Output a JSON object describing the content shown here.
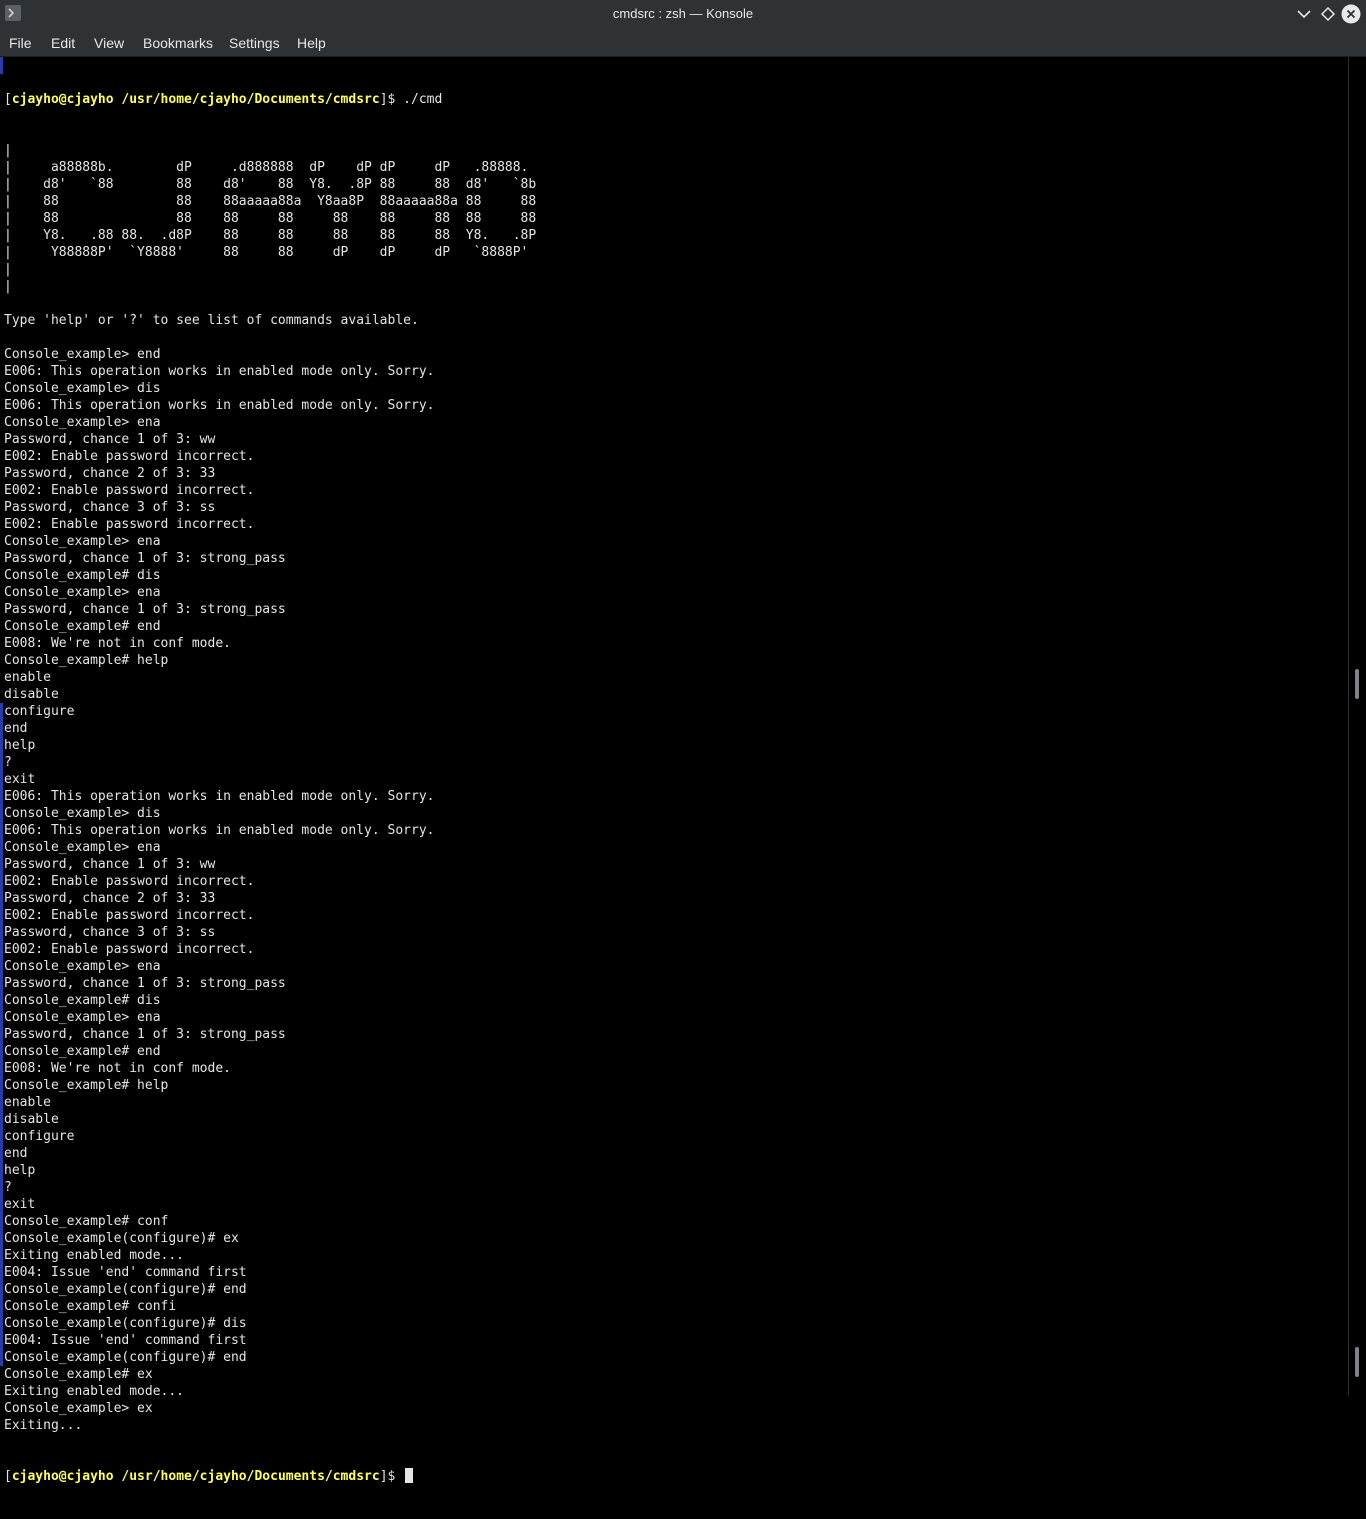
{
  "window": {
    "title": "cmdsrc : zsh — Konsole",
    "icons": {
      "app": "terminal-icon",
      "minimize": "chevron-down-icon",
      "maximize": "diamond-icon",
      "close": "close-icon"
    }
  },
  "menu": {
    "items": [
      "File",
      "Edit",
      "View",
      "Bookmarks",
      "Settings",
      "Help"
    ]
  },
  "colors": {
    "background": "#000000",
    "text": "#e5e5e5",
    "prompt": "#ffff55",
    "chrome": "#2f3235",
    "marker": "#2c3aa8"
  },
  "prompt": {
    "open": "[",
    "user_host": "cjayho@cjayho",
    "path": "/usr/home/cjayho/Documents/cmdsrc",
    "close": "]$ ",
    "first_command": "./cmd"
  },
  "terminal": {
    "lines": [
      "|",
      "|     a88888b.        dP     .d888888  dP    dP dP     dP   .88888.",
      "|    d8'   `88        88    d8'    88  Y8.  .8P 88     88  d8'   `8b",
      "|    88               88    88aaaaa88a  Y8aa8P  88aaaaa88a 88     88",
      "|    88               88    88     88     88    88     88  88     88",
      "|    Y8.   .88 88.  .d8P    88     88     88    88     88  Y8.   .8P",
      "|     Y88888P'  `Y8888'     88     88     dP    dP     dP   `8888P'",
      "|",
      "|",
      "",
      "Type 'help' or '?' to see list of commands available.",
      "",
      "Console_example> end",
      "E006: This operation works in enabled mode only. Sorry.",
      "Console_example> dis",
      "E006: This operation works in enabled mode only. Sorry.",
      "Console_example> ena",
      "Password, chance 1 of 3: ww",
      "E002: Enable password incorrect.",
      "Password, chance 2 of 3: 33",
      "E002: Enable password incorrect.",
      "Password, chance 3 of 3: ss",
      "E002: Enable password incorrect.",
      "Console_example> ena",
      "Password, chance 1 of 3: strong_pass",
      "Console_example# dis",
      "Console_example> ena",
      "Password, chance 1 of 3: strong_pass",
      "Console_example# end",
      "E008: We're not in conf mode.",
      "Console_example# help",
      "enable",
      "disable",
      "configure",
      "end",
      "help",
      "?",
      "exit",
      "E006: This operation works in enabled mode only. Sorry.",
      "Console_example> dis",
      "E006: This operation works in enabled mode only. Sorry.",
      "Console_example> ena",
      "Password, chance 1 of 3: ww",
      "E002: Enable password incorrect.",
      "Password, chance 2 of 3: 33",
      "E002: Enable password incorrect.",
      "Password, chance 3 of 3: ss",
      "E002: Enable password incorrect.",
      "Console_example> ena",
      "Password, chance 1 of 3: strong_pass",
      "Console_example# dis",
      "Console_example> ena",
      "Password, chance 1 of 3: strong_pass",
      "Console_example# end",
      "E008: We're not in conf mode.",
      "Console_example# help",
      "enable",
      "disable",
      "configure",
      "end",
      "help",
      "?",
      "exit",
      "Console_example# conf",
      "Console_example(configure)# ex",
      "Exiting enabled mode...",
      "E004: Issue 'end' command first",
      "Console_example(configure)# end",
      "Console_example# confi",
      "Console_example(configure)# dis",
      "E004: Issue 'end' command first",
      "Console_example(configure)# end",
      "Console_example# ex",
      "Exiting enabled mode...",
      "Console_example> ex",
      "Exiting..."
    ]
  }
}
